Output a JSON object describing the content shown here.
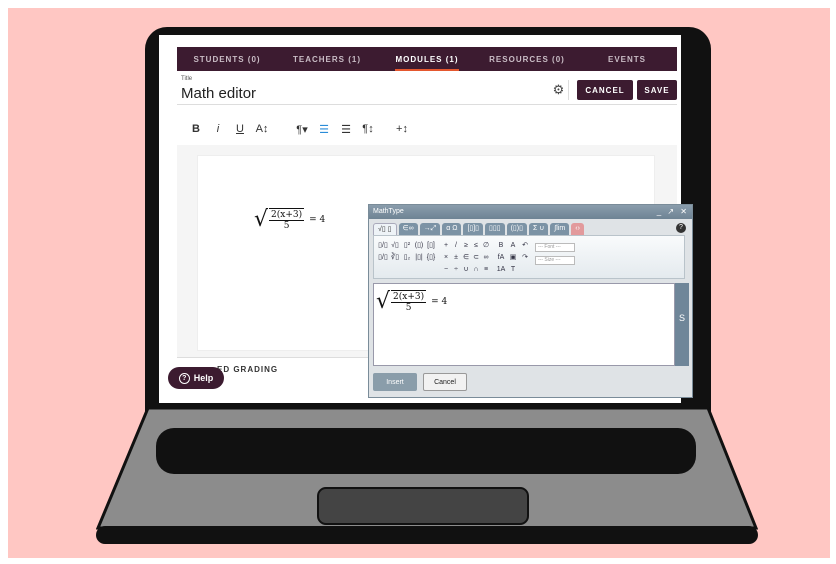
{
  "tabs": [
    {
      "label": "STUDENTS (0)"
    },
    {
      "label": "TEACHERS (1)"
    },
    {
      "label": "MODULES (1)"
    },
    {
      "label": "RESOURCES (0)"
    },
    {
      "label": "EVENTS"
    }
  ],
  "active_tab": "MODULES (1)",
  "title_field": {
    "label": "Title",
    "value": "Math editor"
  },
  "actions": {
    "cancel": "CANCEL",
    "save": "SAVE",
    "settings_icon": "gear-icon"
  },
  "toolbar": {
    "bold": "B",
    "italic": "i",
    "underline": "U",
    "font_size": "A↕",
    "paragraph": "¶▾",
    "align": "☰",
    "align2": "☰",
    "format": "¶↕",
    "insert": "+↕"
  },
  "formula": {
    "numerator": "2(x+3)",
    "denominator": "5",
    "equals": "= 4"
  },
  "section": {
    "label": "ED GRADING"
  },
  "help": {
    "label": "Help"
  },
  "mathtype": {
    "title": "MathType",
    "window_controls": "_ ↗ ✕",
    "tabs": [
      "√▯ ▯",
      "∈∞",
      "→⤢",
      "α Ω",
      "[▯]▯",
      "▯▯▯",
      "(▯)▯",
      "Σ ∪",
      "∫lim",
      "‹›"
    ],
    "palette": {
      "group1": [
        "▯/▯",
        "√▯",
        "▯²",
        "(▯)",
        "[▯]",
        "▯/▯",
        "∛▯",
        "▯₂",
        "|▯|",
        "{▯}"
      ],
      "group2": [
        "+",
        "/",
        "≥",
        "≤",
        "∅",
        "×",
        "±",
        "∈",
        "⊂",
        "∞",
        "−",
        "÷",
        "∪",
        "∩",
        "≡"
      ],
      "group3": [
        "B",
        "A",
        "↶",
        "fA",
        "▣",
        "↷",
        "1A",
        "T"
      ],
      "font_placeholder": "--- Font ---",
      "size_placeholder": "--- Size ---"
    },
    "insert_label": "Insert",
    "cancel_label": "Cancel",
    "side_glyph": "S"
  },
  "colors": {
    "brand": "#3c1b30",
    "accent": "#e4572e",
    "background": "#ffc7c3"
  }
}
